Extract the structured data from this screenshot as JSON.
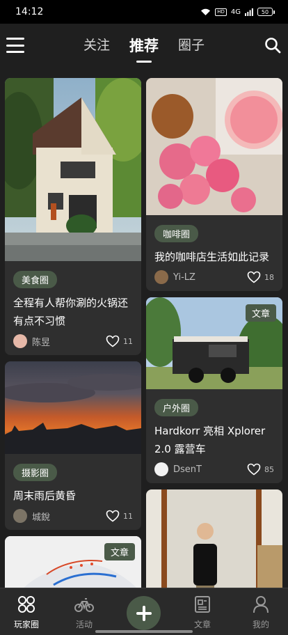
{
  "status": {
    "time": "14:12",
    "hd": "HD",
    "signal": "4G",
    "battery": "50"
  },
  "nav": {
    "tabs": [
      {
        "label": "关注"
      },
      {
        "label": "推荐"
      },
      {
        "label": "圈子"
      }
    ],
    "active_tab": "推荐"
  },
  "cards": [
    {
      "tag": "美食圈",
      "title": "全程有人帮你涮的火锅还有点不习惯",
      "author": "陈昱",
      "likes": "11"
    },
    {
      "tag": "咖啡圈",
      "title": "我的咖啡店生活如此记录",
      "author": "Yi-LZ",
      "likes": "18"
    },
    {
      "tag": "户外圈",
      "title": "Hardkorr 亮相 Xplorer 2.0 露营车",
      "author": "DsenT",
      "likes": "85",
      "badge": "文章"
    },
    {
      "tag": "摄影圈",
      "title": "周末雨后黄昏",
      "author": "城銳",
      "likes": "11"
    },
    {
      "badge": "文章"
    }
  ],
  "bottom_nav": [
    {
      "label": "玩家圈",
      "icon": "grid-icon",
      "active": true
    },
    {
      "label": "活动",
      "icon": "bike-icon"
    },
    {
      "label": "",
      "icon": "plus-icon"
    },
    {
      "label": "文章",
      "icon": "article-icon"
    },
    {
      "label": "我的",
      "icon": "person-icon"
    }
  ],
  "colors": {
    "background": "#1f1f1f",
    "card": "#2f2f2f",
    "accent_green": "#4a5a48"
  }
}
